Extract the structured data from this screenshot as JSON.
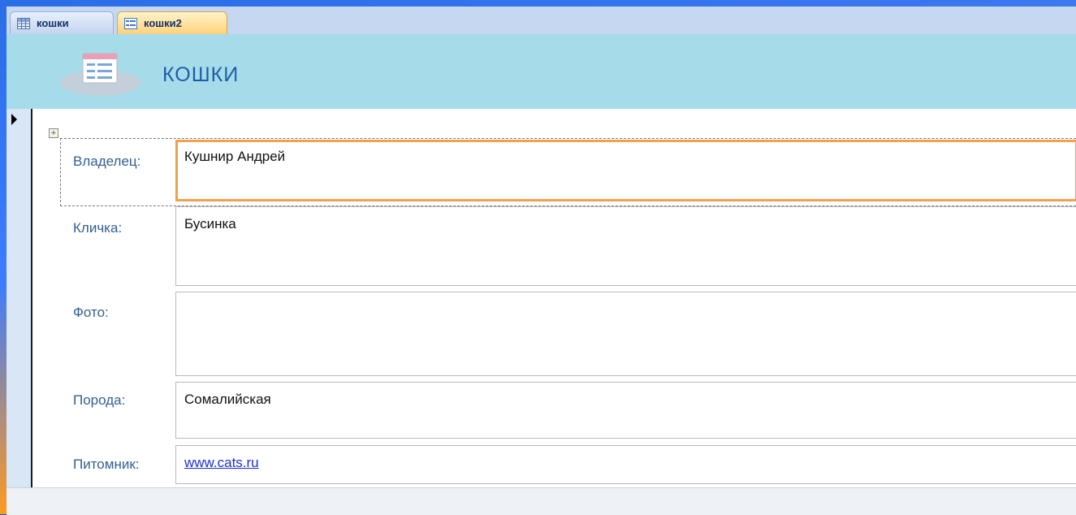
{
  "tabs": [
    {
      "label": "кошки",
      "icon": "table-icon",
      "active": false
    },
    {
      "label": "кошки2",
      "icon": "form-icon",
      "active": true
    }
  ],
  "header": {
    "title": "КОШКИ",
    "icon": "form-icon"
  },
  "fields": [
    {
      "label": "Владелец:",
      "value": "Кушнир Андрей"
    },
    {
      "label": "Кличка:",
      "value": "Бусинка"
    },
    {
      "label": "Фото:",
      "value": ""
    },
    {
      "label": "Порода:",
      "value": "Сомалийская"
    },
    {
      "label": "Питомник:",
      "value": "www.cats.ru"
    }
  ],
  "colors": {
    "header_bg": "#a6dbea",
    "label_text": "#335f8f",
    "active_field_border": "#f0a14a",
    "hyperlink": "#1c2fd6",
    "active_tab": "#ffd27b"
  }
}
